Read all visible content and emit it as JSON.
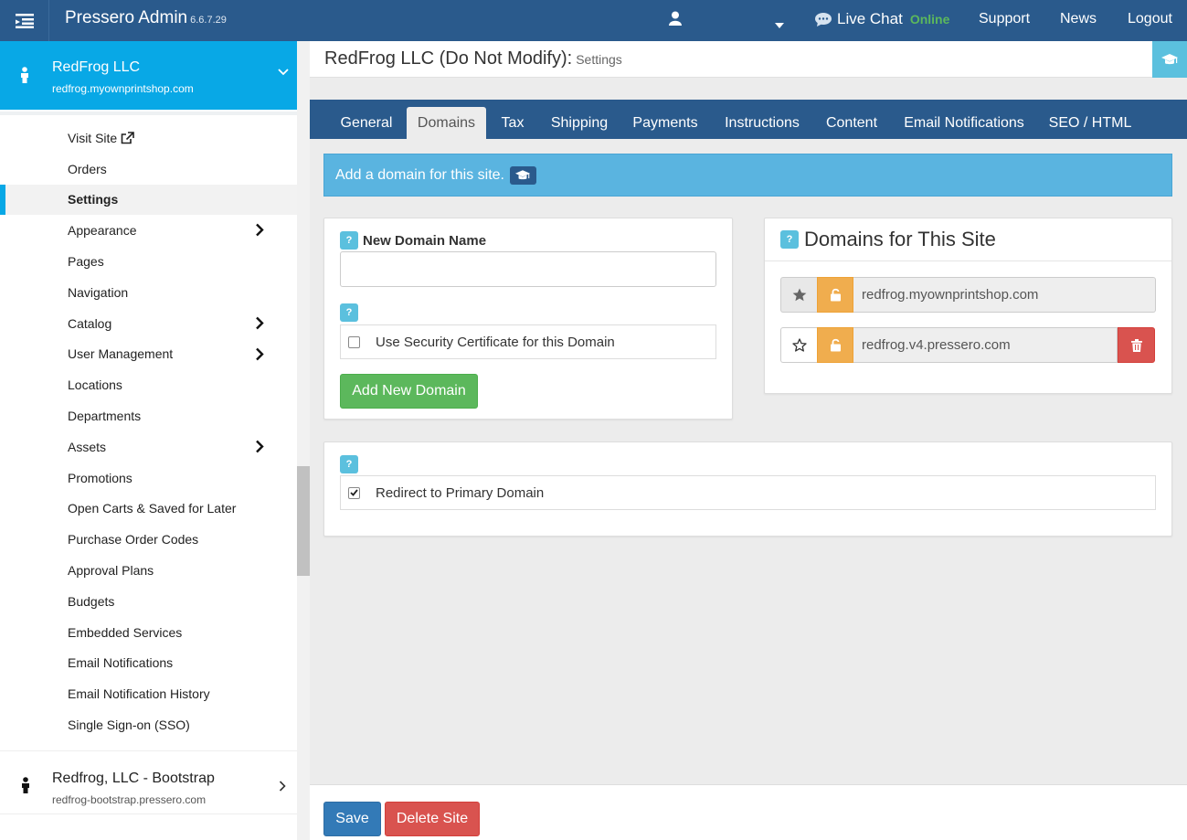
{
  "topbar": {
    "brand": "Pressero Admin",
    "version": "6.6.7.29",
    "live_chat": "Live Chat",
    "chat_status": "Online",
    "links": [
      "Support",
      "News",
      "Logout"
    ]
  },
  "sidebar": {
    "current_site": {
      "name": "RedFrog LLC",
      "url": "redfrog.myownprintshop.com"
    },
    "items": [
      {
        "label": "Visit Site",
        "external": true
      },
      {
        "label": "Orders"
      },
      {
        "label": "Settings",
        "active": true
      },
      {
        "label": "Appearance",
        "submenu": true
      },
      {
        "label": "Pages"
      },
      {
        "label": "Navigation"
      },
      {
        "label": "Catalog",
        "submenu": true
      },
      {
        "label": "User Management",
        "submenu": true
      },
      {
        "label": "Locations"
      },
      {
        "label": "Departments"
      },
      {
        "label": "Assets",
        "submenu": true
      },
      {
        "label": "Promotions"
      },
      {
        "label": "Open Carts & Saved for Later"
      },
      {
        "label": "Purchase Order Codes"
      },
      {
        "label": "Approval Plans"
      },
      {
        "label": "Budgets"
      },
      {
        "label": "Embedded Services"
      },
      {
        "label": "Email Notifications"
      },
      {
        "label": "Email Notification History"
      },
      {
        "label": "Single Sign-on (SSO)"
      }
    ],
    "other_site": {
      "name": "Redfrog, LLC - Bootstrap",
      "url": "redfrog-bootstrap.pressero.com"
    }
  },
  "header": {
    "title": "RedFrog LLC (Do Not Modify):",
    "subtitle": "Settings"
  },
  "tabs": [
    "General",
    "Domains",
    "Tax",
    "Shipping",
    "Payments",
    "Instructions",
    "Content",
    "Email Notifications",
    "SEO / HTML"
  ],
  "active_tab": "Domains",
  "info_bar": {
    "text": "Add a domain for this site."
  },
  "new_domain": {
    "help": "?",
    "label": "New Domain Name",
    "value": "",
    "ssl_label": "Use Security Certificate for this Domain",
    "ssl_checked": false,
    "add_button": "Add New Domain"
  },
  "domains_panel": {
    "help": "?",
    "title": "Domains for This Site",
    "domains": [
      {
        "name": "redfrog.myownprintshop.com",
        "primary": true
      },
      {
        "name": "redfrog.v4.pressero.com",
        "primary": false
      }
    ]
  },
  "redirect": {
    "help": "?",
    "label": "Redirect to Primary Domain",
    "checked": true
  },
  "footer": {
    "save": "Save",
    "delete": "Delete Site"
  },
  "colors": {
    "topbar": "#2a5a8c",
    "sidebar_accent": "#08a8e6",
    "info": "#5ab4e0",
    "help": "#5bc0de",
    "success": "#5cb85c",
    "warning": "#f0ad4e",
    "danger": "#d9534f",
    "primary": "#337ab7"
  }
}
